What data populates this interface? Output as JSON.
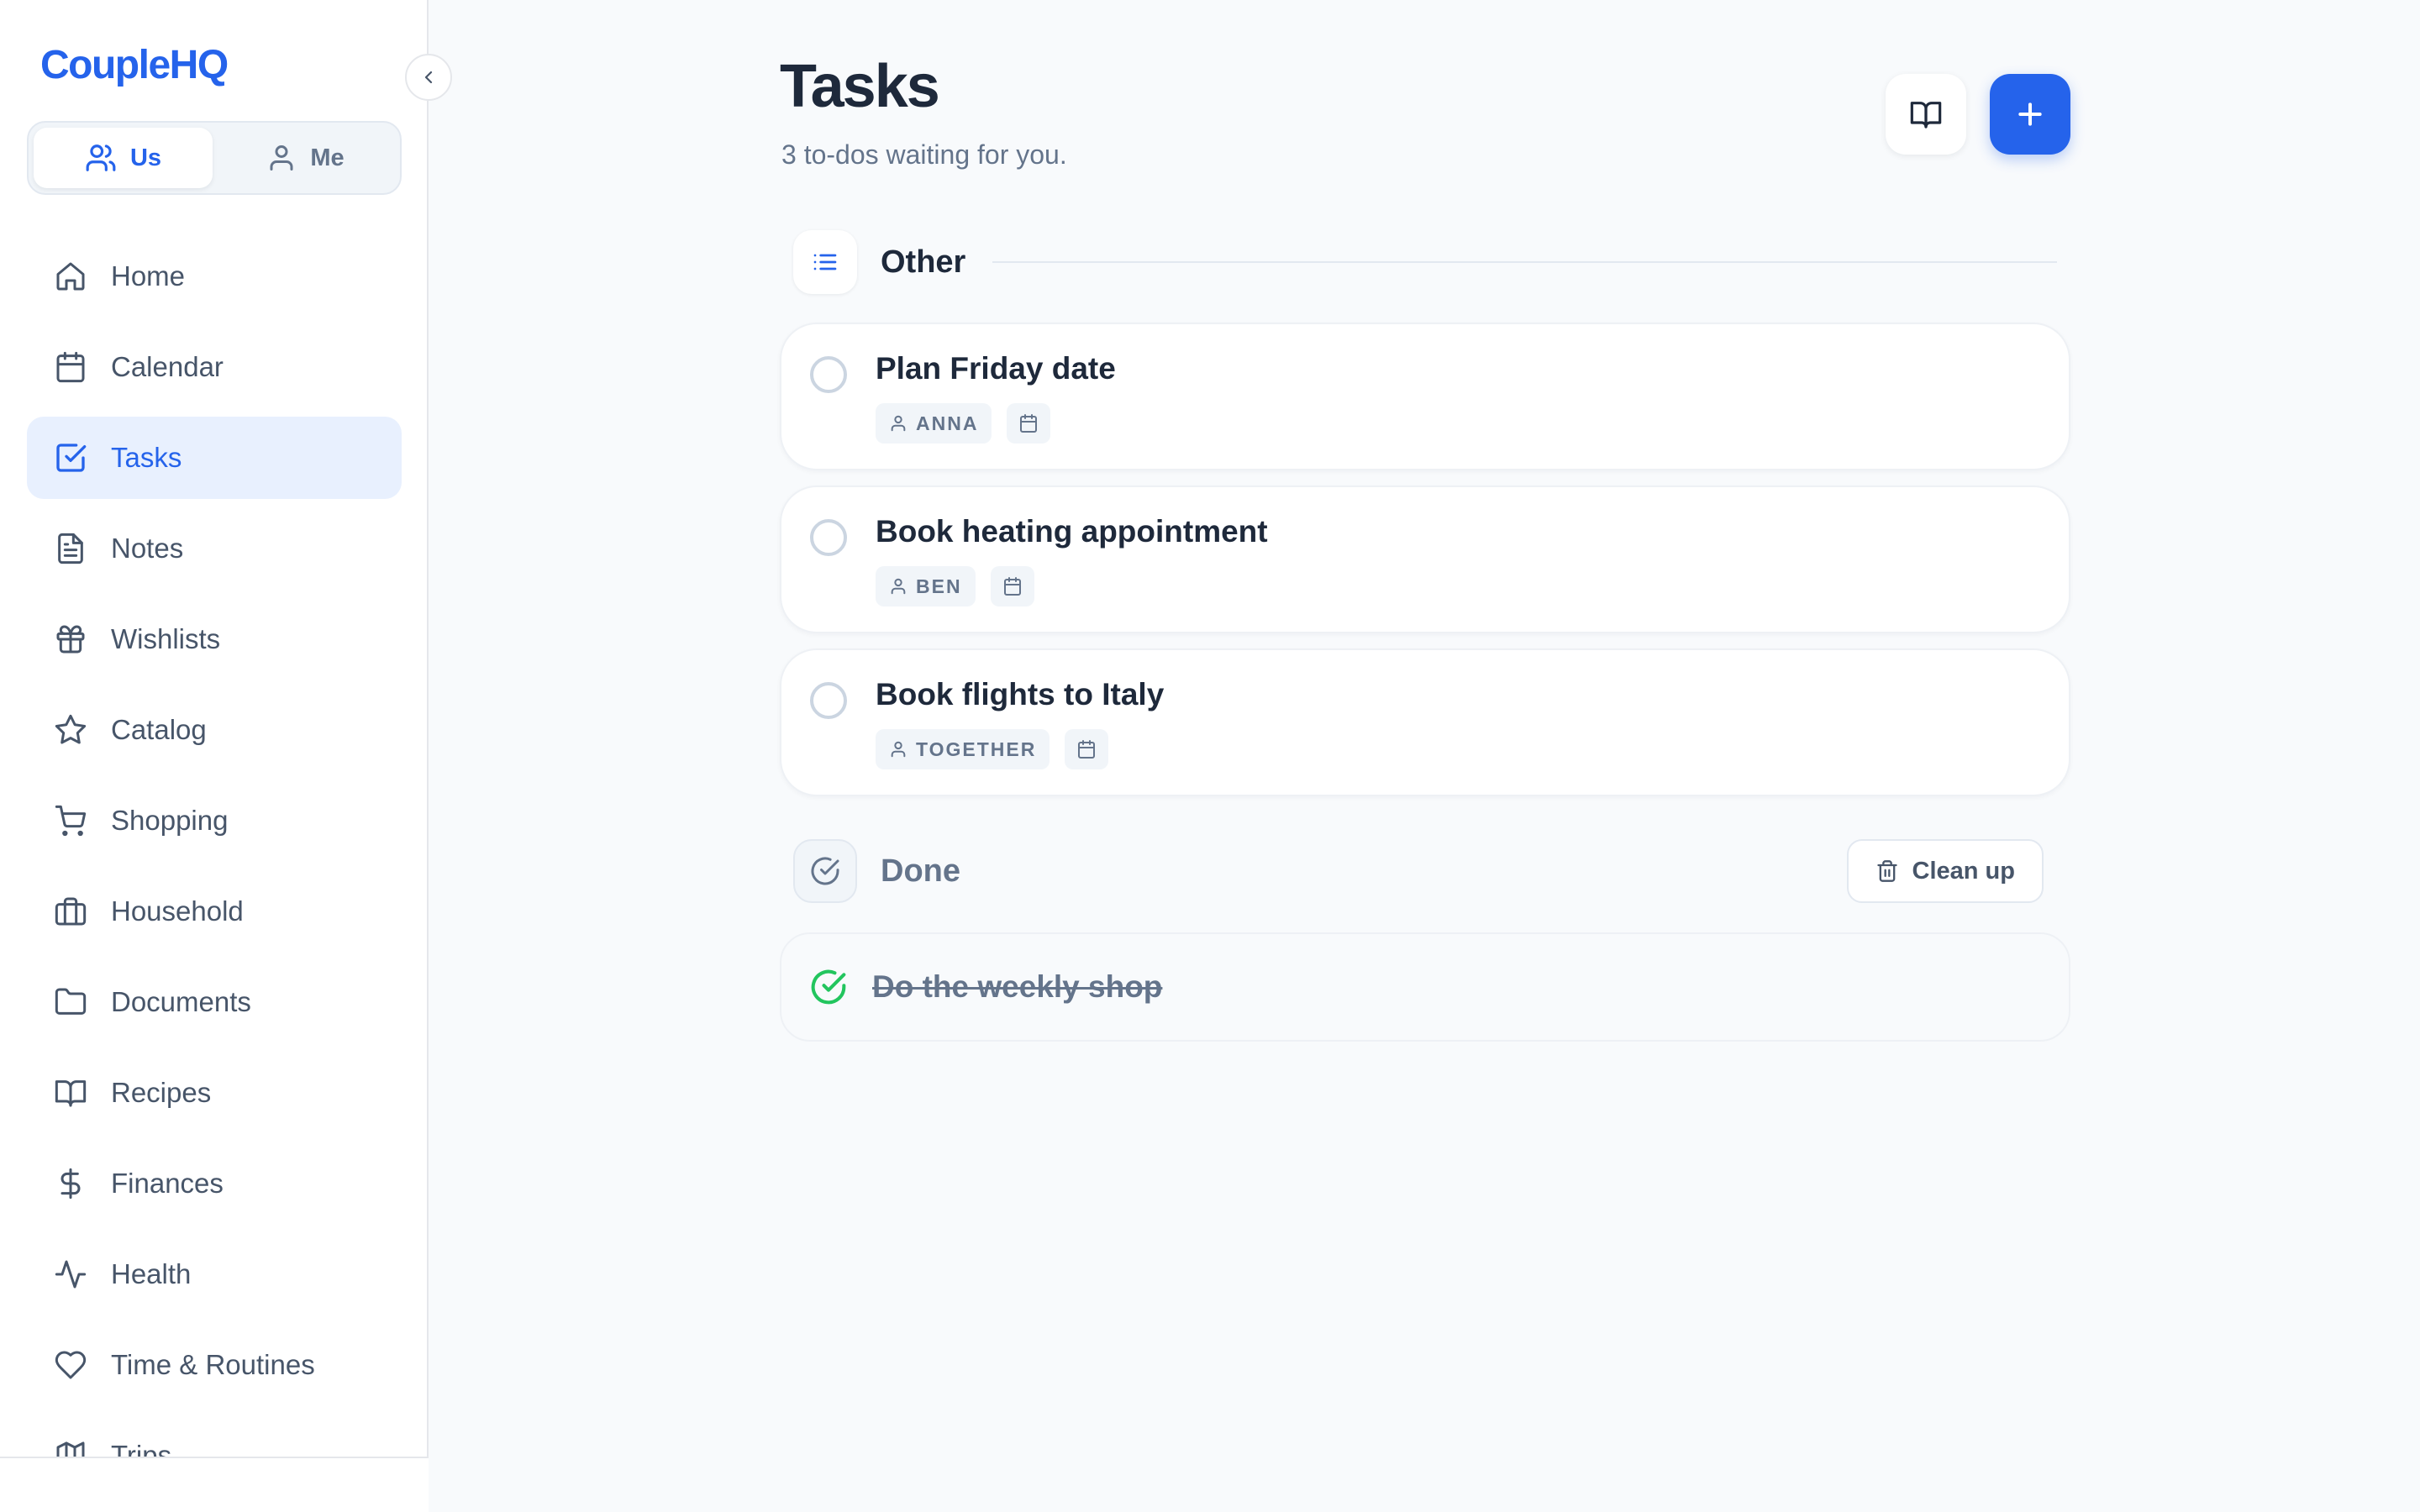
{
  "app": {
    "name": "CoupleHQ"
  },
  "scope": {
    "us_label": "Us",
    "me_label": "Me",
    "active": "us"
  },
  "sidebar": {
    "items": [
      {
        "label": "Home",
        "icon": "home-icon"
      },
      {
        "label": "Calendar",
        "icon": "calendar-icon"
      },
      {
        "label": "Tasks",
        "icon": "check-square-icon",
        "active": true
      },
      {
        "label": "Notes",
        "icon": "file-text-icon"
      },
      {
        "label": "Wishlists",
        "icon": "gift-icon"
      },
      {
        "label": "Catalog",
        "icon": "star-icon"
      },
      {
        "label": "Shopping",
        "icon": "cart-icon"
      },
      {
        "label": "Household",
        "icon": "briefcase-icon"
      },
      {
        "label": "Documents",
        "icon": "folder-icon"
      },
      {
        "label": "Recipes",
        "icon": "book-open-icon"
      },
      {
        "label": "Finances",
        "icon": "dollar-icon"
      },
      {
        "label": "Health",
        "icon": "activity-icon"
      },
      {
        "label": "Time & Routines",
        "icon": "heart-icon"
      },
      {
        "label": "Trips",
        "icon": "map-icon"
      }
    ]
  },
  "header": {
    "title": "Tasks",
    "subtitle": "3 to-dos waiting for you."
  },
  "sections": {
    "other": {
      "title": "Other",
      "tasks": [
        {
          "title": "Plan Friday date",
          "assignee": "ANNA"
        },
        {
          "title": "Book heating appointment",
          "assignee": "BEN"
        },
        {
          "title": "Book flights to Italy",
          "assignee": "TOGETHER"
        }
      ]
    },
    "done": {
      "title": "Done",
      "cleanup_label": "Clean up",
      "tasks": [
        {
          "title": "Do the weekly shop"
        }
      ]
    }
  },
  "colors": {
    "accent": "#2563eb",
    "success": "#22c55e",
    "background": "#f8fafc"
  }
}
